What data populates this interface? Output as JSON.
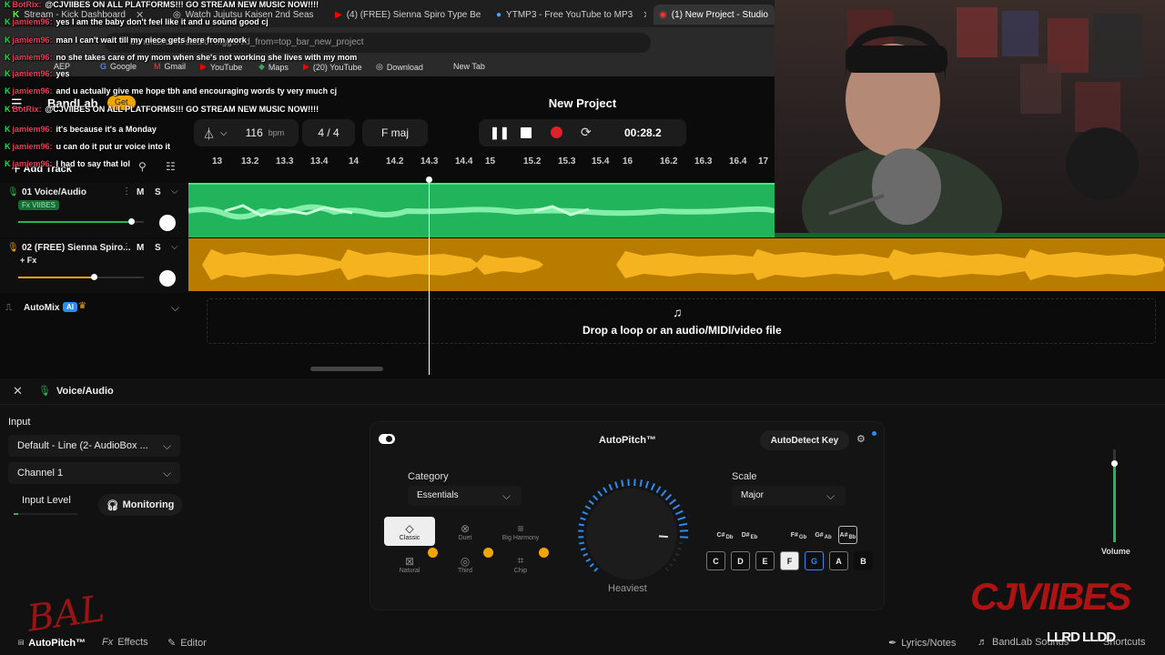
{
  "browser": {
    "tabs": [
      {
        "label": "Stream - Kick Dashboard",
        "icon": "kick-icon"
      },
      {
        "label": "Watch Jujutsu Kaisen 2nd Seas",
        "icon": "globe-icon"
      },
      {
        "label": "(4) (FREE) Sienna Spiro Type Be",
        "icon": "youtube-icon"
      },
      {
        "label": "YTMP3 - Free YouTube to MP3",
        "icon": "globe-icon"
      },
      {
        "label": "(1) New Project - Studio",
        "icon": "bandlab-icon"
      }
    ],
    "url": "bandlab.com/studio?triggered_from=top_bar_new_project",
    "bookmarks": [
      "AEP",
      "Google",
      "Gmail",
      "YouTube",
      "Maps",
      "(20) YouTube",
      "Download",
      "New Tab"
    ]
  },
  "chat": [
    {
      "user": "BotRix:",
      "text": "@CJVIIBES ON ALL PLATFORMS!!! GO STREAM NEW MUSIC NOW!!!!"
    },
    {
      "user": "jamiem96:",
      "text": "yes I am the baby don't feel like it and u sound good cj"
    },
    {
      "user": "jamiem96:",
      "text": "man I can't wait till my niece gets here from work"
    },
    {
      "user": "jamiem96:",
      "text": "no she takes care of my mom when she's not working she lives with my mom"
    },
    {
      "user": "jamiem96:",
      "text": "yes"
    },
    {
      "user": "jamiem96:",
      "text": "and u actually give me hope tbh and encouraging words ty very much cj"
    },
    {
      "user": "BotRix:",
      "text": "@CJVIIBES ON ALL PLATFORMS!!! GO STREAM NEW MUSIC NOW!!!!"
    },
    {
      "user": "jamiem96:",
      "text": "it's because it's a Monday"
    },
    {
      "user": "jamiem96:",
      "text": "u can do it put ur voice into it"
    },
    {
      "user": "jamiem96:",
      "text": "I had to say that lol"
    }
  ],
  "studio": {
    "logo": "BandLab",
    "get_label": "Get",
    "project_title": "New Project",
    "bpm_value": "116",
    "bpm_unit": "bpm",
    "time_signature": "4 / 4",
    "key": "F maj",
    "time": "00:28.2",
    "add_track": "Add Track",
    "ruler": [
      "13",
      "13.2",
      "13.3",
      "13.4",
      "14",
      "14.2",
      "14.3",
      "14.4",
      "15",
      "15.2",
      "15.3",
      "15.4",
      "16",
      "16.2",
      "16.3",
      "16.4",
      "17"
    ],
    "tracks": [
      {
        "name": "01  Voice/Audio",
        "fx": "Fx VIIBES",
        "color": "#1db954",
        "volume": 0.9
      },
      {
        "name": "02  (FREE) Sienna Spiro...",
        "fx": "+ Fx",
        "color": "#f0a500",
        "volume": 0.6
      }
    ],
    "mute_label": "M",
    "solo_label": "S",
    "automix": "AutoMix",
    "ai_badge": "AI",
    "drop_text": "Drop a loop or an audio/MIDI/video file"
  },
  "panel": {
    "track_title": "Voice/Audio",
    "input_label": "Input",
    "input_device": "Default - Line (2- AudioBox ...",
    "channel": "Channel 1",
    "input_level": "Input Level",
    "monitoring": "Monitoring",
    "autopitch_title": "AutoPitch™",
    "autodetect": "AutoDetect Key",
    "category_label": "Category",
    "category_value": "Essentials",
    "styles": [
      "Classic",
      "Duet",
      "Big Harmony",
      "Natural",
      "Third",
      "Chip"
    ],
    "knob_label": "Heaviest",
    "knob_value": 0.85,
    "scale_label": "Scale",
    "scale_value": "Major",
    "sharps": [
      {
        "top": "C#",
        "bottom": "Db"
      },
      {
        "top": "D#",
        "bottom": "Eb"
      },
      {
        "top": "F#",
        "bottom": "Gb"
      },
      {
        "top": "G#",
        "bottom": "Ab"
      },
      {
        "top": "A#",
        "bottom": "Bb"
      }
    ],
    "naturals": [
      "C",
      "D",
      "E",
      "F",
      "G",
      "A",
      "B"
    ],
    "volume_label": "Volume",
    "volume_value": 0.85,
    "bottom_tabs": [
      "AutoPitch™",
      "Effects",
      "Editor"
    ],
    "bottom_right": [
      "Lyrics/Notes",
      "BandLab Sounds",
      "Shortcuts"
    ]
  },
  "overlay": {
    "logo_left": "BAL",
    "brand": "CJVIIBES",
    "footer_tag": "LLRD LLDD"
  },
  "colors": {
    "green": "#1db954",
    "orange": "#f0a500",
    "accent_blue": "#2d8cf0",
    "record_red": "#e0202a"
  }
}
